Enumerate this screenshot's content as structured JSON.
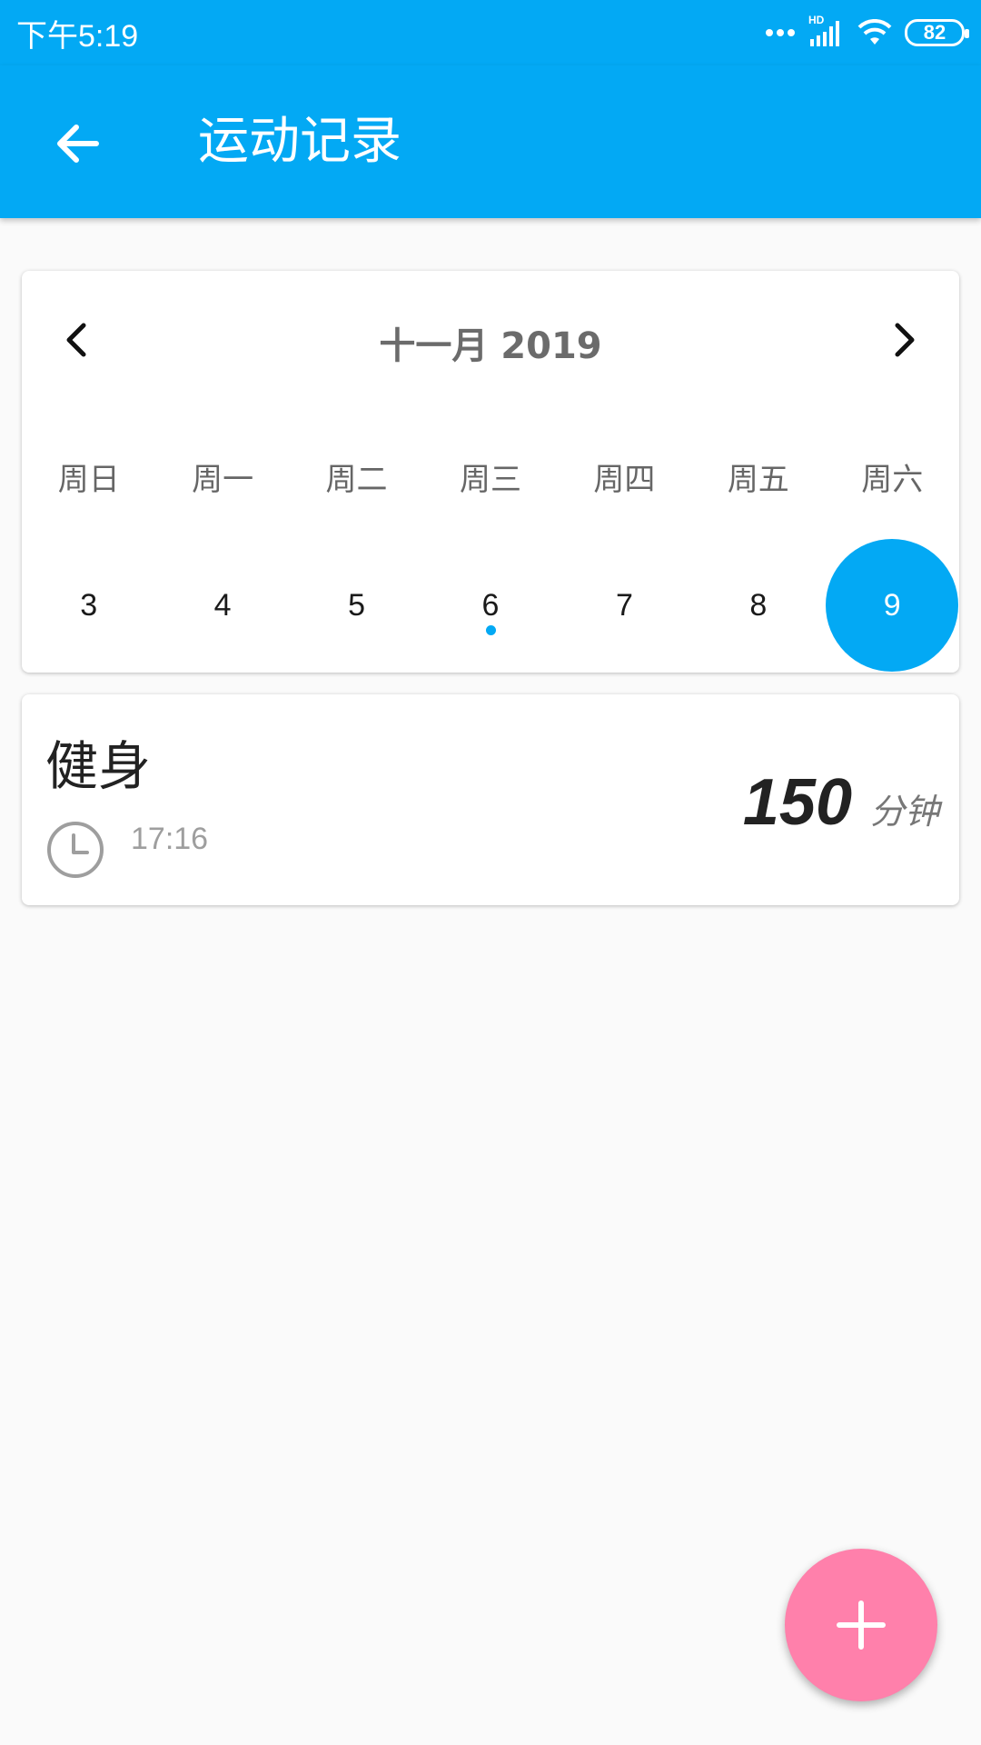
{
  "status_bar": {
    "time": "下午5:19",
    "network_label": "HD",
    "battery_level": "82",
    "icons": [
      "dots-icon",
      "signal-icon",
      "wifi-icon",
      "battery-icon"
    ]
  },
  "app_bar": {
    "title": "运动记录",
    "back_icon": "arrow-left-icon",
    "color": "#03a9f4"
  },
  "calendar": {
    "month_label": "十一月 2019",
    "prev_icon": "chevron-left-icon",
    "next_icon": "chevron-right-icon",
    "weekdays": [
      "周日",
      "周一",
      "周二",
      "周三",
      "周四",
      "周五",
      "周六"
    ],
    "days": [
      "3",
      "4",
      "5",
      "6",
      "7",
      "8",
      "9"
    ],
    "selected_day": "9",
    "marked_days": [
      "6"
    ],
    "accent_color": "#03a9f4"
  },
  "records": [
    {
      "title": "健身",
      "time": "17:16",
      "value": "150",
      "unit": "分钟",
      "clock_icon": "clock-icon"
    }
  ],
  "fab": {
    "icon": "plus-icon",
    "color": "#ff80ab"
  }
}
